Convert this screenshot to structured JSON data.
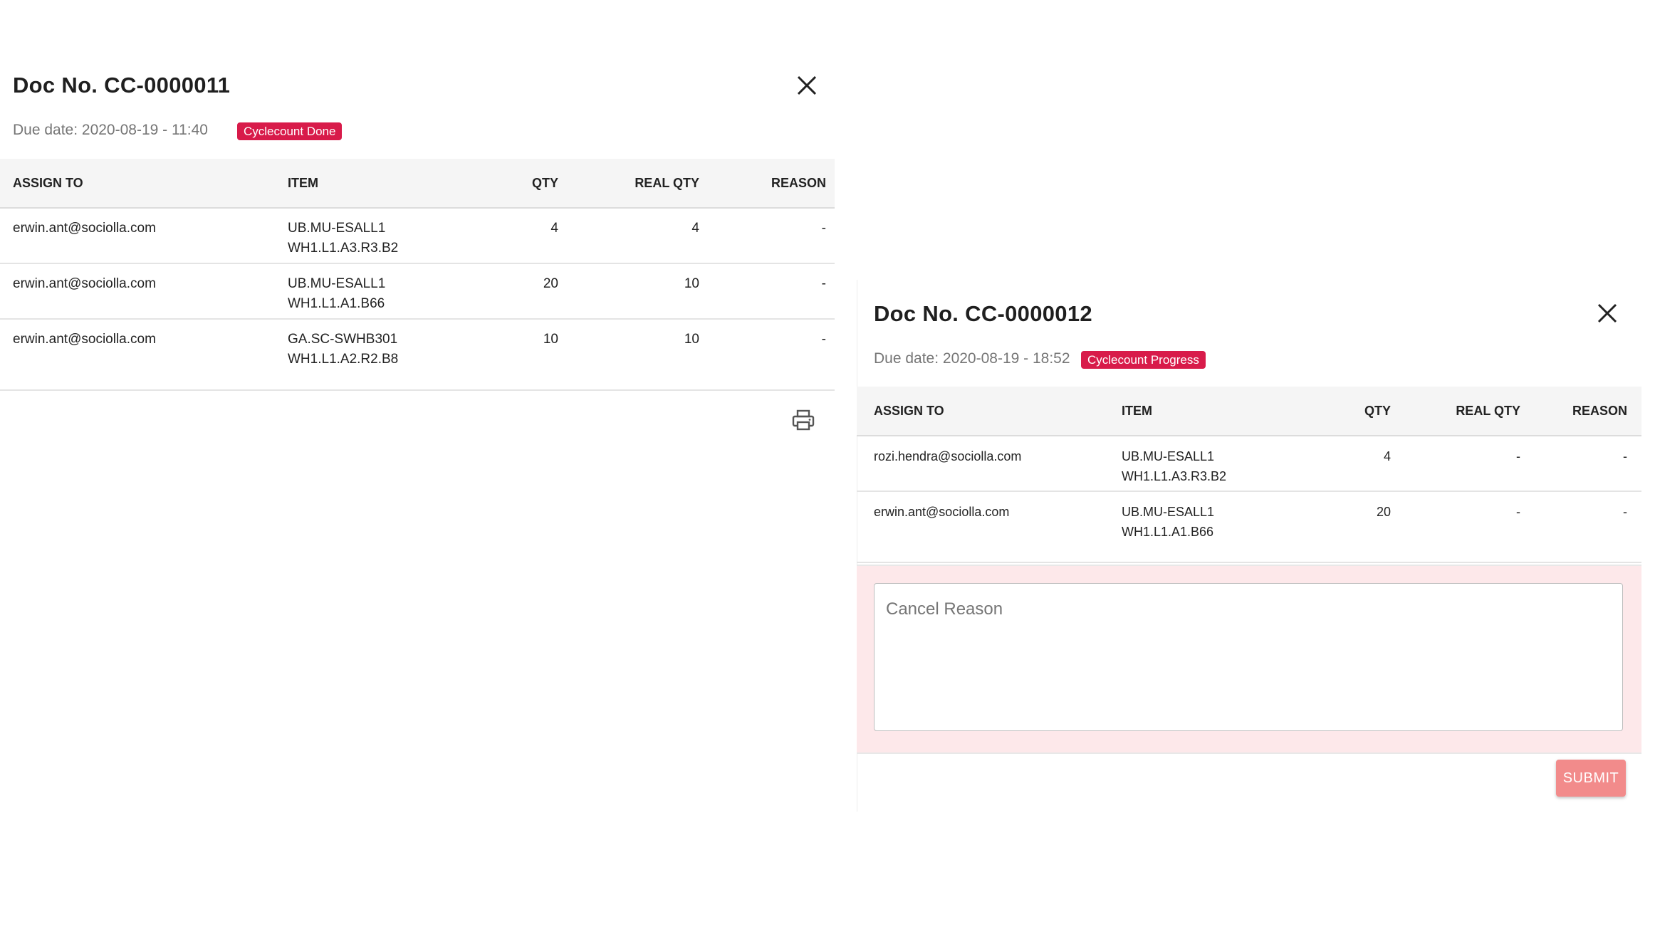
{
  "dialog1": {
    "title": "Doc No. CC-0000011",
    "due_date": "Due date: 2020-08-19 - 11:40",
    "status": "Cyclecount Done",
    "columns": [
      "ASSIGN TO",
      "ITEM",
      "QTY",
      "REAL QTY",
      "REASON"
    ],
    "rows": [
      {
        "assign_to": "erwin.ant@sociolla.com",
        "item_code": "UB.MU-ESALL1",
        "item_location": "WH1.L1.A3.R3.B2",
        "qty": "4",
        "real_qty": "4",
        "reason": "-"
      },
      {
        "assign_to": "erwin.ant@sociolla.com",
        "item_code": "UB.MU-ESALL1",
        "item_location": "WH1.L1.A1.B66",
        "qty": "20",
        "real_qty": "10",
        "reason": "-"
      },
      {
        "assign_to": "erwin.ant@sociolla.com",
        "item_code": "GA.SC-SWHB301",
        "item_location": "WH1.L1.A2.R2.B8",
        "qty": "10",
        "real_qty": "10",
        "reason": "-"
      }
    ],
    "close_icon": "close-icon",
    "print_icon": "print-icon"
  },
  "dialog2": {
    "title": "Doc No. CC-0000012",
    "due_date": "Due date: 2020-08-19 - 18:52",
    "status": "Cyclecount Progress",
    "columns": [
      "ASSIGN TO",
      "ITEM",
      "QTY",
      "REAL QTY",
      "REASON"
    ],
    "rows": [
      {
        "assign_to": "rozi.hendra@sociolla.com",
        "item_code": "UB.MU-ESALL1",
        "item_location": "WH1.L1.A3.R3.B2",
        "qty": "4",
        "real_qty": "-",
        "reason": "-"
      },
      {
        "assign_to": "erwin.ant@sociolla.com",
        "item_code": "UB.MU-ESALL1",
        "item_location": "WH1.L1.A1.B66",
        "qty": "20",
        "real_qty": "-",
        "reason": "-"
      }
    ],
    "cancel_reason": {
      "value": "",
      "placeholder": "Cancel Reason"
    },
    "submit_label": "SUBMIT",
    "close_icon": "close-icon"
  },
  "colors": {
    "badge": "#d81b4a",
    "submit": "#f28b8b",
    "cancel_panel": "#fde8ea",
    "header_bg": "#f5f5f5"
  }
}
